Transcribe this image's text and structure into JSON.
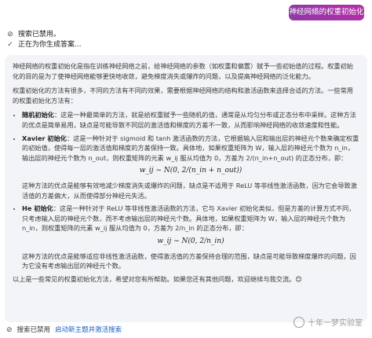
{
  "user_message": "神经网络的权重初始化",
  "status": {
    "search_disabled": "搜索已禁用。",
    "generating": "正在为你生成答案..."
  },
  "answer": {
    "intro": "神经网络的权重初始化是指在训练神经网络之前，给神经网络的参数（如权重和偏置）赋予一些初始值的过程。权重初始化的目的是为了使神经网络能够更快地收敛，避免梯度消失或爆炸的问题，以及提高神经网络的泛化能力。",
    "methods_intro": "权重初始化的方法有很多，不同的方法有不同的效果，需要根据神经网络的结构和激活函数来选择合适的方法。一些常用的权重初始化方法有：",
    "items": [
      {
        "title": "随机初始化",
        "text": "：这是一种最简单的方法，就是给权重赋予一些随机的值，通常是从均匀分布或正态分布中采样。这种方法的优点是简单易用，缺点是可能导致不同层的激活值和梯度的方差不一致，从而影响神经网络的收敛速度和性能。"
      },
      {
        "title": "Xavier 初始化",
        "text": "：这是一种针对于 sigmoid 和 tanh 激活函数的方法，它根据输入层和输出层的神经元个数来确定权重的初始值，使得每一层的激活值和梯度的方差保持一致。具体地，如果权重矩阵为 W，输入层的神经元个数为 n_in，输出层的神经元个数为 n_out，则权重矩阵的元素 w_ij 服从均值为 0，方差为 2/(n_in+n_out) 的正态分布，即：",
        "formula": "w_ij ~ N(0, 2/(n_in + n_out))",
        "after": "这种方法的优点是能够有效地减少梯度消失或爆炸的问题，缺点是不适用于 ReLU 等非线性激活函数，因为它会导致激活值的方差偏大，从而使得部分神经元失活。"
      },
      {
        "title": "He 初始化",
        "text": "：这是一种针对于 ReLU 等非线性激活函数的方法，它与 Xavier 初始化类似，但是方差的计算方式不同，只考虑输入层的神经元个数，而不考虑输出层的神经元个数。具体地，如果权重矩阵为 W，输入层的神经元个数为 n_in，则权重矩阵的元素 w_ij 服从均值为 0，方差为 2/n_in 的正态分布，即：",
        "formula": "w_ij ~ N(0, 2/n_in)",
        "after": "这种方法的优点是能够适应非线性激活函数，使得激活值的方差保持合理的范围，缺点是可能导致梯度爆炸的问题，因为它没有考虑输出层的神经元个数。"
      }
    ],
    "closing": "以上是一些常见的权重初始化方法，希望对您有所帮助。如果您还有其他问题，欢迎继续与我交流。😊"
  },
  "footer": {
    "search_disabled": "搜索已禁用",
    "new_topic_link": "启动新主题并激活搜索"
  },
  "watermark": "十年一梦实验室",
  "colors": {
    "bubble_start": "#8e3aa6",
    "bubble_end": "#b22fa8",
    "card_bg": "#f3f4f7",
    "link": "#1f5fbf"
  },
  "icons": {
    "status_1": "search-disabled-icon",
    "status_2": "check-icon",
    "footer": "search-disabled-icon",
    "watermark": "logo-icon"
  }
}
